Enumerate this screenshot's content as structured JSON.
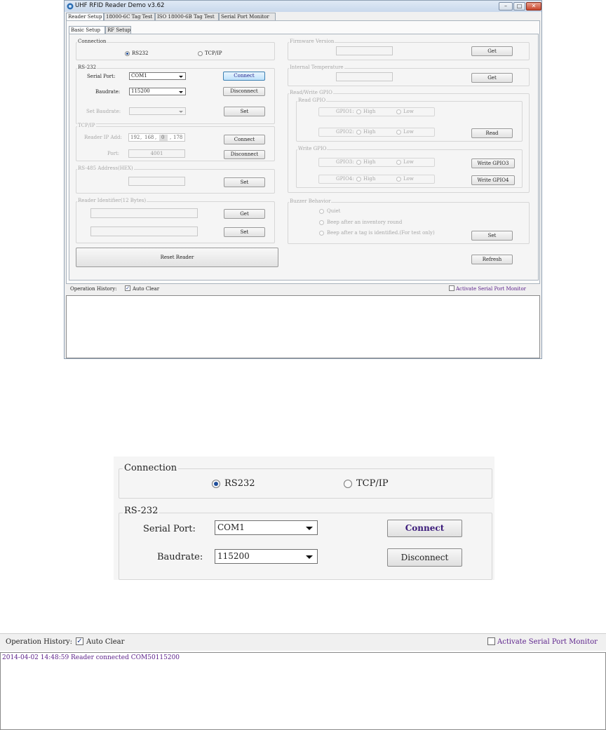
{
  "window": {
    "title": "UHF RFID Reader Demo v3.62",
    "controls": {
      "minimize": "–",
      "maximize": "□",
      "close": "✕"
    }
  },
  "main_tabs": [
    "Reader Setup",
    "18000-6C Tag Test",
    "ISO 18000-6B Tag Test",
    "Serial Port Monitor"
  ],
  "sub_tabs": [
    "Basic Setup",
    "RF Setup"
  ],
  "connection": {
    "title": "Connection",
    "options": [
      "RS232",
      "TCP/IP"
    ],
    "selected": "RS232"
  },
  "rs232": {
    "title": "RS-232",
    "serial_port_label": "Serial Port:",
    "serial_port_value": "COM1",
    "baudrate_label": "Baudrate:",
    "baudrate_value": "115200",
    "set_baudrate_label": "Set Baudrate:",
    "set_baudrate_value": "",
    "connect": "Connect",
    "disconnect": "Disconnect",
    "set": "Set"
  },
  "tcpip": {
    "title": "TCP/IP",
    "ip_label": "Reader IP Add:",
    "ip": [
      "192",
      "168",
      "0",
      "178"
    ],
    "port_label": "Port:",
    "port_value": "4001",
    "connect": "Connect",
    "disconnect": "Disconnect"
  },
  "rs485": {
    "title": "RS-485 Address(HEX)",
    "set": "Set"
  },
  "identifier": {
    "title": "Reader Identifier(12 Bytes)",
    "get": "Get",
    "set": "Set"
  },
  "reset": "Reset Reader",
  "firmware": {
    "title": "Firmware Version",
    "get": "Get"
  },
  "temperature": {
    "title": "Internal Temperature",
    "get": "Get"
  },
  "gpio": {
    "title": "Read/Write GPIO",
    "read_title": "Read GPIO",
    "write_title": "Write GPIO",
    "gpio1": "GPIO1:",
    "gpio2": "GPIO2:",
    "gpio3": "GPIO3:",
    "gpio4": "GPIO4:",
    "high": "High",
    "low": "Low",
    "read": "Read",
    "write3": "Write GPIO3",
    "write4": "Write GPIO4"
  },
  "buzzer": {
    "title": "Buzzer Behavior",
    "options": [
      "Quiet",
      "Beep after an inventory round",
      "Beep after a tag is identified.(For test only)"
    ],
    "set": "Set"
  },
  "refresh": "Refresh",
  "history": {
    "label": "Operation History:",
    "auto_clear": "Auto Clear",
    "monitor": "Activate Serial Port Monitor",
    "log": [
      "2014-04-02 14:48:59 Reader connected COM50115200"
    ]
  },
  "colors": {
    "accent": "#1f4e9a",
    "log_text": "#5a1f8a",
    "connect_text": "#3a1a7a",
    "monitor_text": "#5a1f8a"
  },
  "icons": {
    "app": "rfid-app-icon",
    "dropdown": "chevron-down-icon"
  }
}
